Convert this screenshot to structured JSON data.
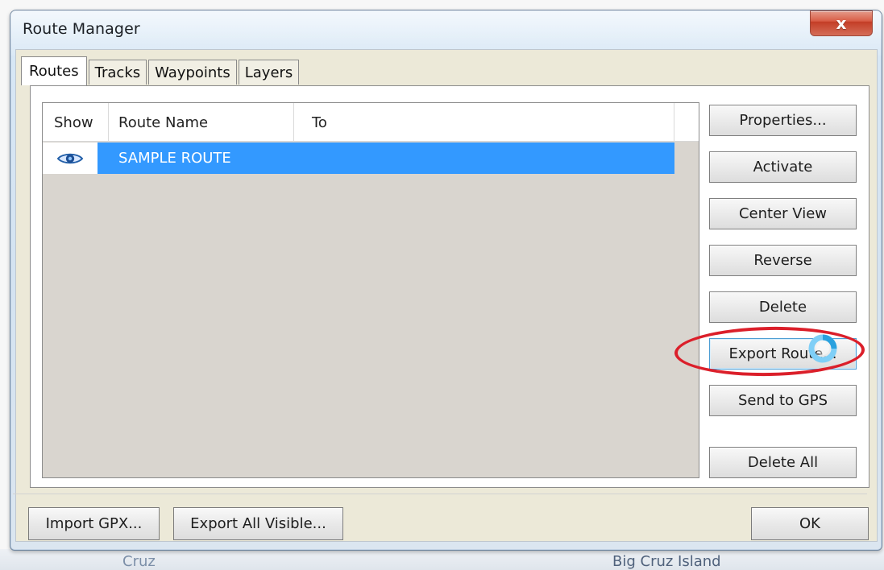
{
  "window": {
    "title": "Route Manager",
    "close_symbol": "x"
  },
  "tabs": [
    {
      "label": "Routes",
      "active": true
    },
    {
      "label": "Tracks",
      "active": false
    },
    {
      "label": "Waypoints",
      "active": false
    },
    {
      "label": "Layers",
      "active": false
    }
  ],
  "table": {
    "columns": [
      {
        "label": "Show"
      },
      {
        "label": "Route Name"
      },
      {
        "label": "To"
      }
    ],
    "rows": [
      {
        "show_icon": "eye-icon",
        "route_name": "SAMPLE ROUTE",
        "to": "",
        "selected": true
      }
    ]
  },
  "buttons": {
    "properties": "Properties...",
    "activate": "Activate",
    "center_view": "Center View",
    "reverse": "Reverse",
    "delete": "Delete",
    "export_route": "Export Route...",
    "send_to_gps": "Send to GPS",
    "delete_all": "Delete All"
  },
  "footer": {
    "import_gpx": "Import GPX...",
    "export_all_visible": "Export All Visible...",
    "ok": "OK"
  },
  "background": {
    "left_text": "Cruz",
    "right_text": "Big Cruz Island"
  },
  "colors": {
    "accent_selection": "#3399ff",
    "highlight_ring": "#db1f2a",
    "close_button": "#d85b44"
  }
}
